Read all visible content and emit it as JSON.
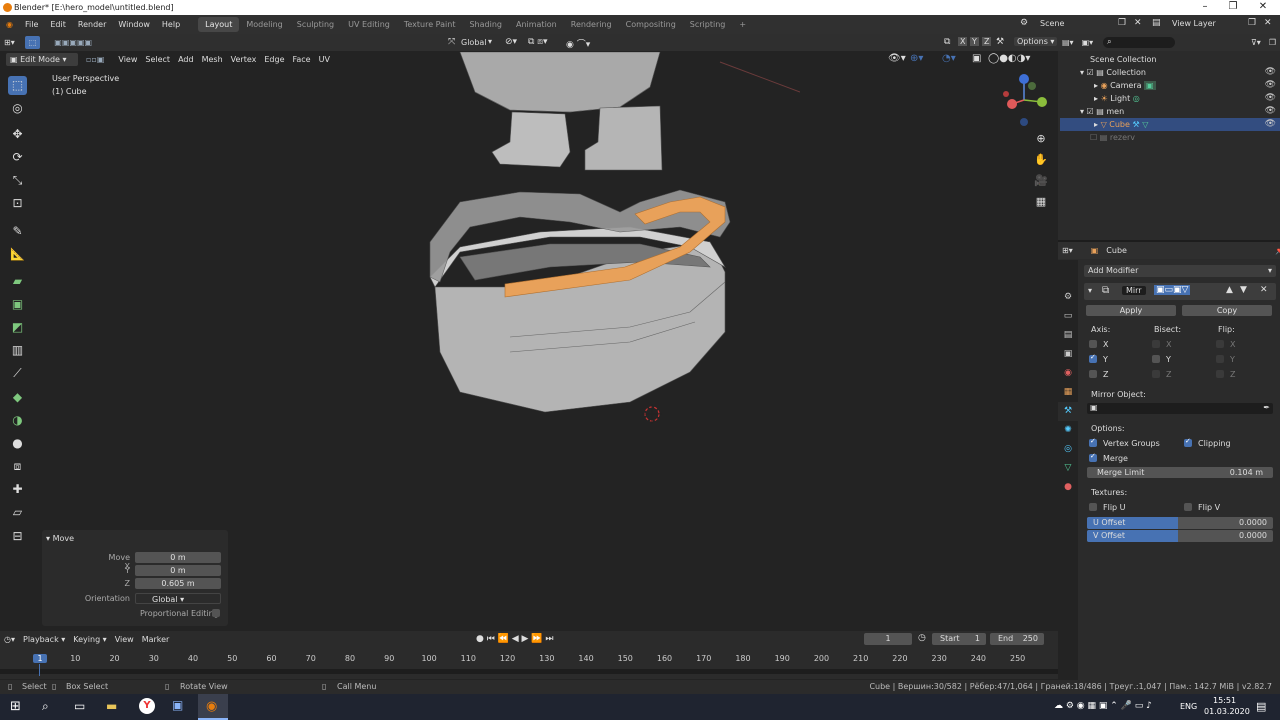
{
  "titlebar": {
    "title": "Blender* [E:\\hero_model\\untitled.blend]"
  },
  "menu": [
    "File",
    "Edit",
    "Render",
    "Window",
    "Help"
  ],
  "workspaces": [
    "Layout",
    "Modeling",
    "Sculpting",
    "UV Editing",
    "Texture Paint",
    "Shading",
    "Animation",
    "Rendering",
    "Compositing",
    "Scripting"
  ],
  "scene": {
    "name": "Scene",
    "view_layer": "View Layer"
  },
  "viewport_header": {
    "mode": "Edit Mode",
    "menus": [
      "View",
      "Select",
      "Add",
      "Mesh",
      "Vertex",
      "Edge",
      "Face",
      "UV"
    ],
    "orientation": "Global",
    "options": "Options",
    "axes": [
      "X",
      "Y",
      "Z"
    ]
  },
  "viewport": {
    "perspective": "User Perspective",
    "object": "(1) Cube"
  },
  "operator_panel": {
    "title": "Move",
    "move_x_label": "Move X",
    "move_x": "0 m",
    "y_label": "Y",
    "y": "0 m",
    "z_label": "Z",
    "z": "0.605 m",
    "orientation_label": "Orientation",
    "orientation": "Global",
    "proportional": "Proportional Editing"
  },
  "outliner": {
    "root": "Scene Collection",
    "items": [
      {
        "name": "Collection"
      },
      {
        "name": "Camera"
      },
      {
        "name": "Light"
      },
      {
        "name": "men"
      },
      {
        "name": "Cube"
      },
      {
        "name": "rezerv"
      }
    ]
  },
  "properties": {
    "object_name": "Cube",
    "add_modifier": "Add Modifier",
    "modifier_name": "Mirr",
    "apply": "Apply",
    "copy": "Copy",
    "axis_label": "Axis:",
    "bisect_label": "Bisect:",
    "flip_label": "Flip:",
    "axes": [
      "X",
      "Y",
      "Z"
    ],
    "mirror_object": "Mirror Object:",
    "options": "Options:",
    "vertex_groups": "Vertex Groups",
    "clipping": "Clipping",
    "merge": "Merge",
    "merge_limit_label": "Merge Limit",
    "merge_limit": "0.104 m",
    "textures": "Textures:",
    "flip_u": "Flip U",
    "flip_v": "Flip V",
    "u_offset_label": "U Offset",
    "u_offset": "0.0000",
    "v_offset_label": "V Offset",
    "v_offset": "0.0000"
  },
  "timeline": {
    "menus": [
      "Playback",
      "Keying",
      "View",
      "Marker"
    ],
    "current_frame": "1",
    "start_label": "Start",
    "start": "1",
    "end_label": "End",
    "end": "250",
    "ticks": [
      "1",
      "10",
      "20",
      "30",
      "40",
      "50",
      "60",
      "70",
      "80",
      "90",
      "100",
      "110",
      "120",
      "130",
      "140",
      "150",
      "160",
      "170",
      "180",
      "190",
      "200",
      "210",
      "220",
      "230",
      "240",
      "250"
    ]
  },
  "statusbar": {
    "select": "Select",
    "box_select": "Box Select",
    "rotate_view": "Rotate View",
    "call_menu": "Call Menu",
    "stats": "Cube | Вершин:30/582 | Рёбер:47/1,064 | Граней:18/486 | Треуг.:1,047 | Пам.: 142.7 MiB | v2.82.7"
  },
  "taskbar": {
    "lang": "ENG",
    "time": "15:51",
    "date": "01.03.2020"
  },
  "colors": {
    "accent": "#4772b3",
    "orange": "#e8a15a",
    "bg": "#232323"
  }
}
